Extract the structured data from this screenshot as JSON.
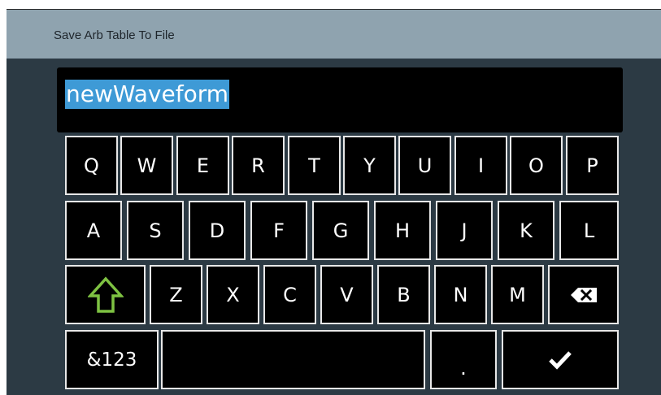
{
  "dialog": {
    "title": "Save Arb Table To File"
  },
  "input": {
    "value": "newWaveform",
    "selected": true
  },
  "keyboard": {
    "row1": [
      "Q",
      "W",
      "E",
      "R",
      "T",
      "Y",
      "U",
      "I",
      "O",
      "P"
    ],
    "row2": [
      "A",
      "S",
      "D",
      "F",
      "G",
      "H",
      "J",
      "K",
      "L"
    ],
    "row3": [
      "Z",
      "X",
      "C",
      "V",
      "B",
      "N",
      "M"
    ],
    "numbers_label": "&123",
    "period_label": ".",
    "shift_icon": "shift-arrow-icon",
    "backspace_icon": "backspace-icon",
    "enter_icon": "checkmark-icon",
    "shift_color": "#7ec242",
    "selection_color": "#3e9ad6"
  }
}
